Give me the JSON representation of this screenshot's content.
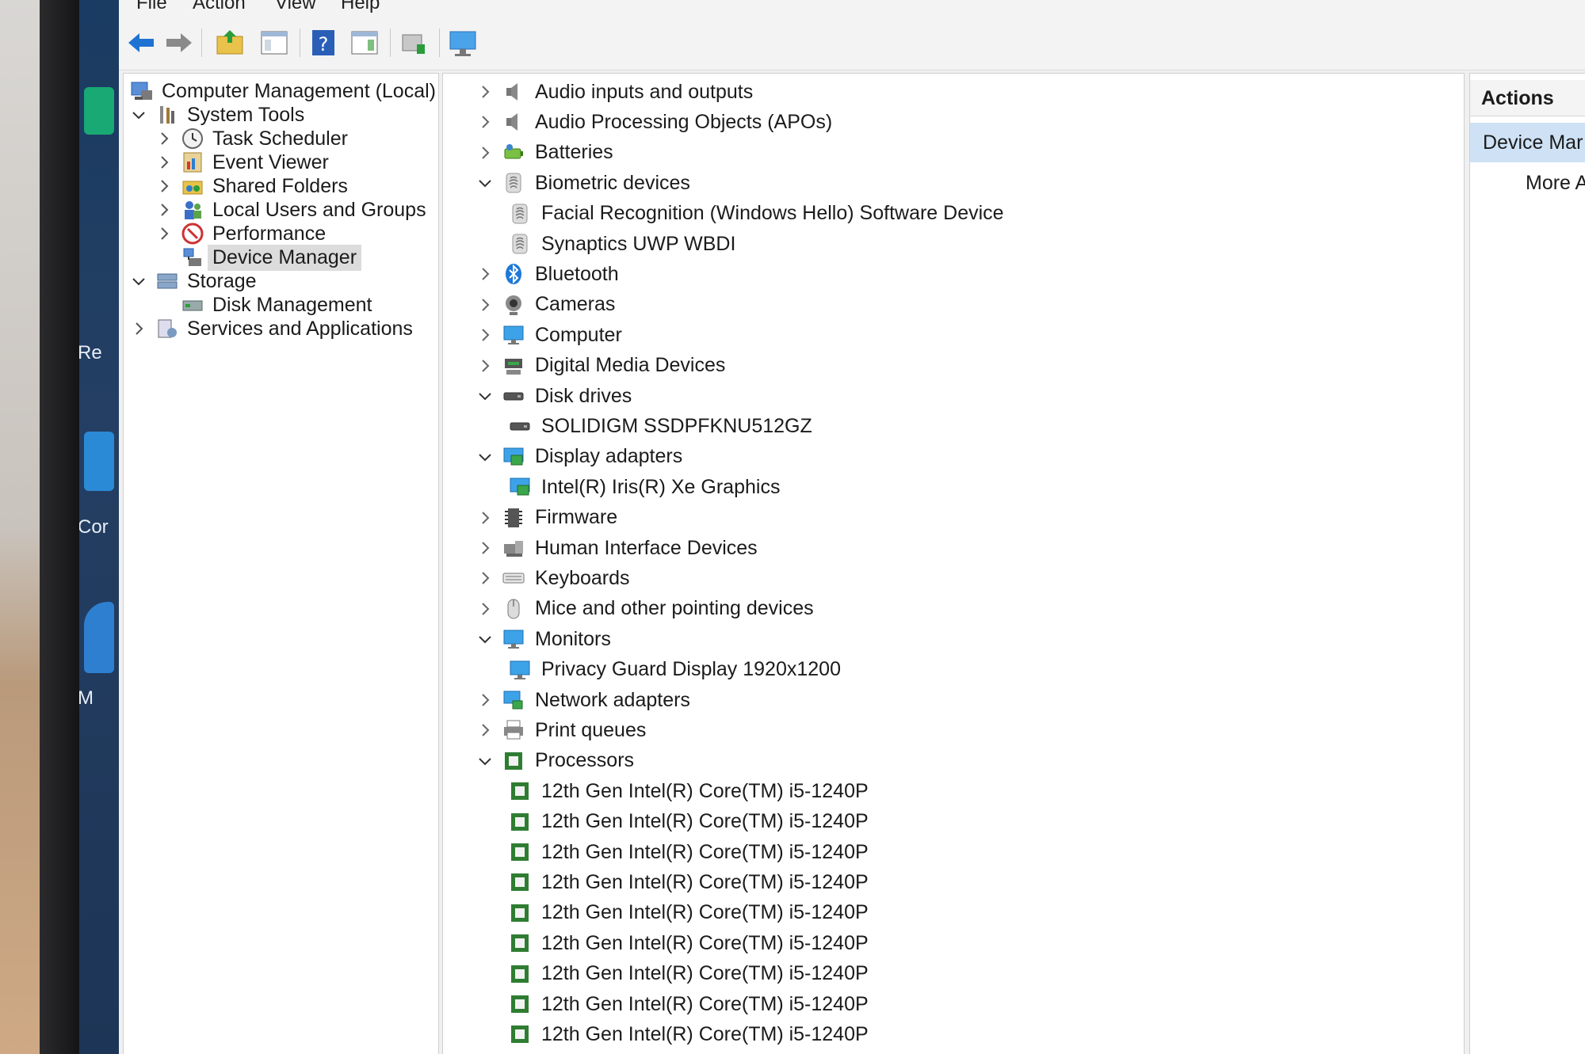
{
  "menubar": {
    "items": [
      "File",
      "Action",
      "View",
      "Help"
    ]
  },
  "tree": {
    "root": "Computer Management (Local)",
    "items": [
      {
        "label": "System Tools",
        "state": "expanded",
        "level": 1,
        "icon": "tools-icon"
      },
      {
        "label": "Task Scheduler",
        "state": "collapsed",
        "level": 2,
        "icon": "clock-icon"
      },
      {
        "label": "Event Viewer",
        "state": "collapsed",
        "level": 2,
        "icon": "event-viewer-icon"
      },
      {
        "label": "Shared Folders",
        "state": "collapsed",
        "level": 2,
        "icon": "shared-folder-icon"
      },
      {
        "label": "Local Users and Groups",
        "state": "collapsed",
        "level": 2,
        "icon": "users-icon"
      },
      {
        "label": "Performance",
        "state": "collapsed",
        "level": 2,
        "icon": "performance-icon"
      },
      {
        "label": "Device Manager",
        "state": "leaf",
        "level": 2,
        "icon": "device-manager-icon",
        "selected": true
      },
      {
        "label": "Storage",
        "state": "expanded",
        "level": 1,
        "icon": "storage-icon"
      },
      {
        "label": "Disk Management",
        "state": "leaf",
        "level": 2,
        "icon": "disk-management-icon"
      },
      {
        "label": "Services and Applications",
        "state": "collapsed",
        "level": 1,
        "icon": "services-icon"
      }
    ]
  },
  "devices": [
    {
      "label": "Audio inputs and outputs",
      "state": "collapsed",
      "level": 0,
      "icon": "speaker-icon"
    },
    {
      "label": "Audio Processing Objects (APOs)",
      "state": "collapsed",
      "level": 0,
      "icon": "speaker-icon"
    },
    {
      "label": "Batteries",
      "state": "collapsed",
      "level": 0,
      "icon": "battery-icon"
    },
    {
      "label": "Biometric devices",
      "state": "expanded",
      "level": 0,
      "icon": "fingerprint-icon"
    },
    {
      "label": "Facial Recognition (Windows Hello) Software Device",
      "state": "leaf",
      "level": 1,
      "icon": "fingerprint-icon"
    },
    {
      "label": "Synaptics UWP WBDI",
      "state": "leaf",
      "level": 1,
      "icon": "fingerprint-icon"
    },
    {
      "label": "Bluetooth",
      "state": "collapsed",
      "level": 0,
      "icon": "bluetooth-icon"
    },
    {
      "label": "Cameras",
      "state": "collapsed",
      "level": 0,
      "icon": "camera-icon"
    },
    {
      "label": "Computer",
      "state": "collapsed",
      "level": 0,
      "icon": "monitor-icon"
    },
    {
      "label": "Digital Media Devices",
      "state": "collapsed",
      "level": 0,
      "icon": "media-device-icon"
    },
    {
      "label": "Disk drives",
      "state": "expanded",
      "level": 0,
      "icon": "disk-drive-icon"
    },
    {
      "label": "SOLIDIGM SSDPFKNU512GZ",
      "state": "leaf",
      "level": 1,
      "icon": "disk-drive-icon"
    },
    {
      "label": "Display adapters",
      "state": "expanded",
      "level": 0,
      "icon": "display-adapter-icon"
    },
    {
      "label": "Intel(R) Iris(R) Xe Graphics",
      "state": "leaf",
      "level": 1,
      "icon": "display-adapter-icon"
    },
    {
      "label": "Firmware",
      "state": "collapsed",
      "level": 0,
      "icon": "firmware-icon"
    },
    {
      "label": "Human Interface Devices",
      "state": "collapsed",
      "level": 0,
      "icon": "hid-icon"
    },
    {
      "label": "Keyboards",
      "state": "collapsed",
      "level": 0,
      "icon": "keyboard-icon"
    },
    {
      "label": "Mice and other pointing devices",
      "state": "collapsed",
      "level": 0,
      "icon": "mouse-icon"
    },
    {
      "label": "Monitors",
      "state": "expanded",
      "level": 0,
      "icon": "monitor-icon"
    },
    {
      "label": "Privacy Guard Display 1920x1200",
      "state": "leaf",
      "level": 1,
      "icon": "monitor-icon"
    },
    {
      "label": "Network adapters",
      "state": "collapsed",
      "level": 0,
      "icon": "network-icon"
    },
    {
      "label": "Print queues",
      "state": "collapsed",
      "level": 0,
      "icon": "printer-icon"
    },
    {
      "label": "Processors",
      "state": "expanded",
      "level": 0,
      "icon": "processor-icon"
    },
    {
      "label": "12th Gen Intel(R) Core(TM) i5-1240P",
      "state": "leaf",
      "level": 1,
      "icon": "processor-icon"
    },
    {
      "label": "12th Gen Intel(R) Core(TM) i5-1240P",
      "state": "leaf",
      "level": 1,
      "icon": "processor-icon"
    },
    {
      "label": "12th Gen Intel(R) Core(TM) i5-1240P",
      "state": "leaf",
      "level": 1,
      "icon": "processor-icon"
    },
    {
      "label": "12th Gen Intel(R) Core(TM) i5-1240P",
      "state": "leaf",
      "level": 1,
      "icon": "processor-icon"
    },
    {
      "label": "12th Gen Intel(R) Core(TM) i5-1240P",
      "state": "leaf",
      "level": 1,
      "icon": "processor-icon"
    },
    {
      "label": "12th Gen Intel(R) Core(TM) i5-1240P",
      "state": "leaf",
      "level": 1,
      "icon": "processor-icon"
    },
    {
      "label": "12th Gen Intel(R) Core(TM) i5-1240P",
      "state": "leaf",
      "level": 1,
      "icon": "processor-icon"
    },
    {
      "label": "12th Gen Intel(R) Core(TM) i5-1240P",
      "state": "leaf",
      "level": 1,
      "icon": "processor-icon"
    },
    {
      "label": "12th Gen Intel(R) Core(TM) i5-1240P",
      "state": "leaf",
      "level": 1,
      "icon": "processor-icon"
    }
  ],
  "actions": {
    "title": "Actions",
    "selected": "Device Mar",
    "more": "More A"
  },
  "desktop": {
    "labels": [
      "Re",
      "Cor",
      "M"
    ]
  },
  "colors": {
    "accent": "#2f7fd6",
    "selection": "#cfe2f5",
    "processor": "#2e7d32"
  }
}
